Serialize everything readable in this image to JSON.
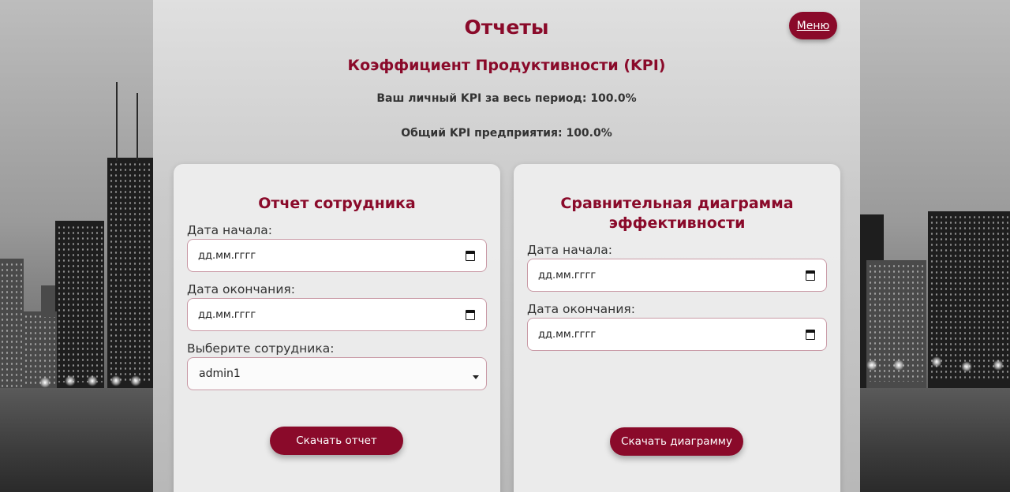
{
  "header": {
    "title": "Отчеты",
    "menu_label": "Меню"
  },
  "kpi": {
    "title": "Коэффициент Продуктивности (KPI)",
    "personal": "Ваш личный KPI за весь период: 100.0%",
    "company": "Общий KPI предприятия: 100.0%"
  },
  "employee_report": {
    "title": "Отчет сотрудника",
    "start_label": "Дата начала:",
    "start_placeholder": "дд.мм.гггг",
    "end_label": "Дата окончания:",
    "end_placeholder": "дд.мм.гггг",
    "employee_label": "Выберите сотрудника:",
    "employee_selected": "admin1",
    "download_label": "Скачать отчет"
  },
  "comparison_chart": {
    "title_line1": "Сравнительная диаграмма",
    "title_line2": "эффективности",
    "start_label": "Дата начала:",
    "start_placeholder": "дд.мм.гггг",
    "end_label": "Дата окончания:",
    "end_placeholder": "дд.мм.гггг",
    "download_label": "Скачать диаграмму"
  },
  "colors": {
    "accent": "#8a0a2a",
    "input_border": "#c99aa6"
  }
}
